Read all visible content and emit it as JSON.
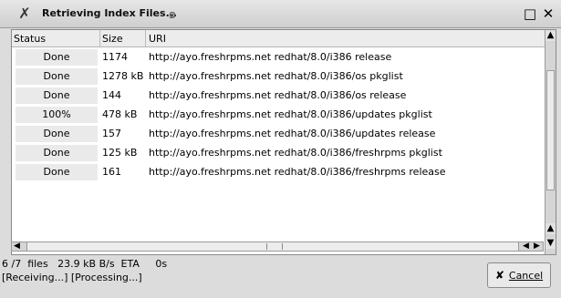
{
  "window": {
    "title": "Retrieving Index Files...",
    "icons": {
      "app": "x-logo-icon",
      "swirl": "swirl-icon",
      "maximize": "maximize-icon",
      "close": "close-icon"
    }
  },
  "table": {
    "headers": {
      "status": "Status",
      "size": "Size",
      "uri": "URI"
    },
    "rows": [
      {
        "status": "Done",
        "size": "1174",
        "uri": "http://ayo.freshrpms.net redhat/8.0/i386 release"
      },
      {
        "status": "Done",
        "size": "1278 kB",
        "uri": "http://ayo.freshrpms.net redhat/8.0/i386/os pkglist"
      },
      {
        "status": "Done",
        "size": "144",
        "uri": "http://ayo.freshrpms.net redhat/8.0/i386/os release"
      },
      {
        "status": "100%",
        "size": "478 kB",
        "uri": "http://ayo.freshrpms.net redhat/8.0/i386/updates pkglist"
      },
      {
        "status": "Done",
        "size": "157",
        "uri": "http://ayo.freshrpms.net redhat/8.0/i386/updates release"
      },
      {
        "status": "Done",
        "size": "125 kB",
        "uri": "http://ayo.freshrpms.net redhat/8.0/i386/freshrpms pkglist"
      },
      {
        "status": "Done",
        "size": "161",
        "uri": "http://ayo.freshrpms.net redhat/8.0/i386/freshrpms release"
      }
    ]
  },
  "progress": {
    "line1": "6 /7  files   23.9 kB B/s  ETA     0s"
  },
  "phase": {
    "text": "[Receiving...] [Processing...]"
  },
  "buttons": {
    "cancel": "Cancel",
    "cancel_icon": "cancel-x-icon"
  }
}
